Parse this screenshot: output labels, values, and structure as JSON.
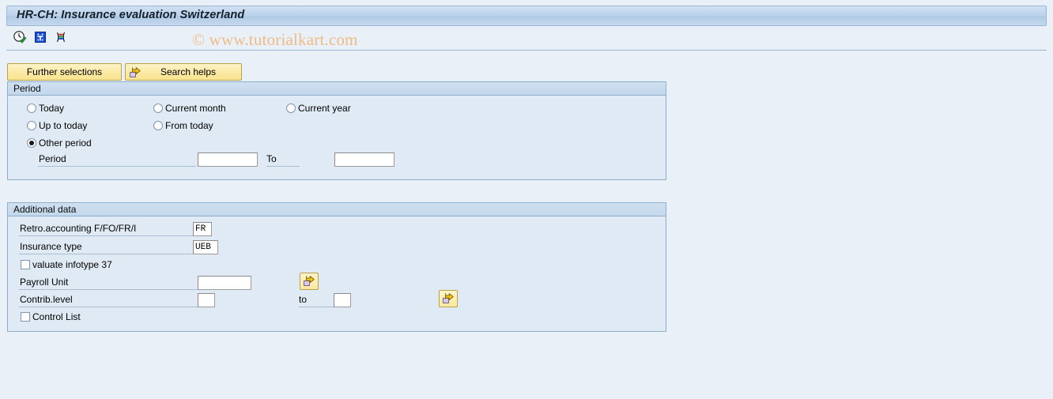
{
  "window": {
    "title": "HR-CH: Insurance evaluation Switzerland"
  },
  "watermark": {
    "text": "© www.tutorialkart.com"
  },
  "toolbar": {
    "icons": [
      {
        "name": "execute-clock-icon",
        "title": "Execute"
      },
      {
        "name": "info-icon",
        "title": "Information"
      },
      {
        "name": "variant-bars-icon",
        "title": "Get Variant"
      }
    ]
  },
  "actions": {
    "further_selections_label": "Further selections",
    "search_helps_label": "Search helps",
    "search_helps_icon": "arrow-right-page-icon"
  },
  "period_group": {
    "title": "Period",
    "options": [
      {
        "label": "Today",
        "selected": false
      },
      {
        "label": "Current month",
        "selected": false
      },
      {
        "label": "Current year",
        "selected": false
      },
      {
        "label": "Up to today",
        "selected": false
      },
      {
        "label": "From today",
        "selected": false
      },
      {
        "label": "Other period",
        "selected": true
      }
    ],
    "period_label": "Period",
    "period_value": "",
    "to_label": "To",
    "to_value": ""
  },
  "additional_group": {
    "title": "Additional data",
    "retro_label": "Retro.accounting F/FO/FR/I",
    "retro_value": "FR",
    "insurance_type_label": "Insurance type",
    "insurance_type_value": "UEB",
    "valuate_infotype_label": "valuate infotype 37",
    "valuate_infotype_checked": false,
    "payroll_unit_label": "Payroll Unit",
    "payroll_unit_value": "",
    "payroll_unit_multi_icon": "arrow-right-page-icon",
    "contrib_level_label": "Contrib.level",
    "contrib_level_from_value": "",
    "contrib_level_to_label": "to",
    "contrib_level_to_value": "",
    "contrib_level_multi_icon": "arrow-right-page-icon",
    "control_list_label": "Control List",
    "control_list_checked": false
  },
  "colors": {
    "page_background": "#eaf0f7",
    "panel_background": "#dfeaf4",
    "panel_border": "#8faec9",
    "titlebar_gradient_top": "#cfe0f2",
    "button_yellow": "#fbeaa6",
    "watermark": "#edb980"
  }
}
